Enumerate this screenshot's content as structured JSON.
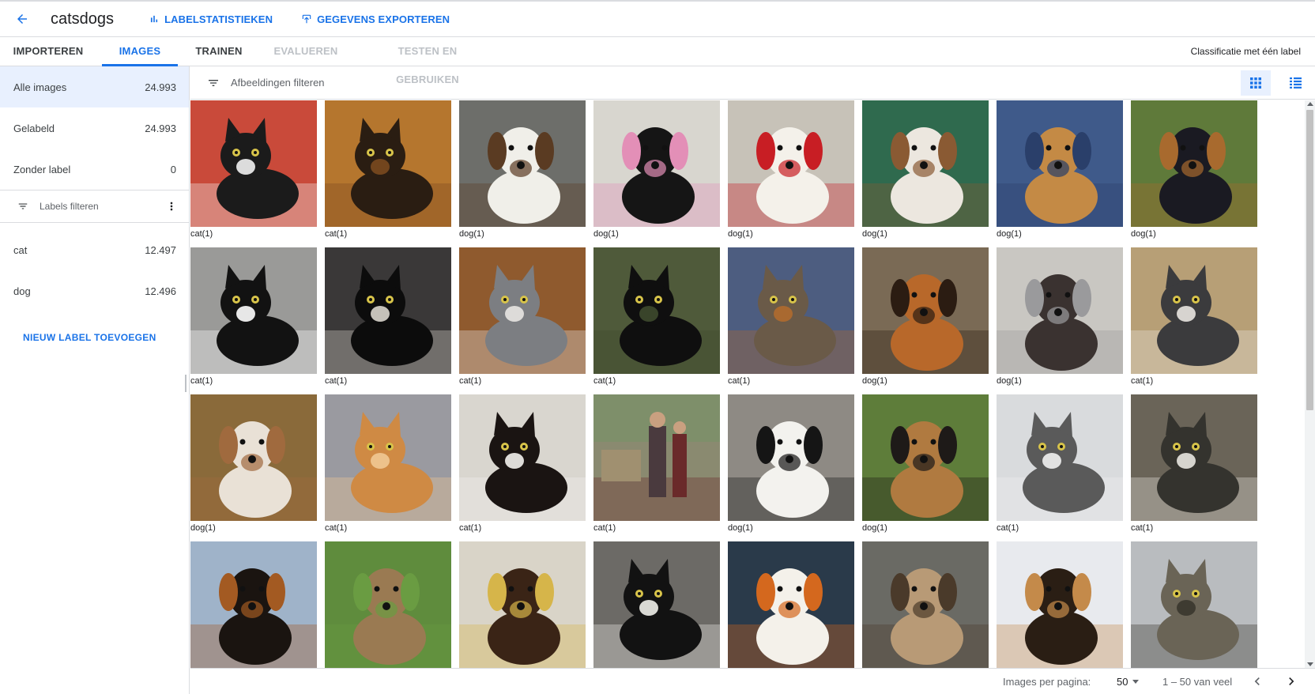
{
  "header": {
    "title": "catsdogs",
    "buttons": [
      {
        "label": "LABELSTATISTIEKEN",
        "icon": "bar-chart-icon"
      },
      {
        "label": "GEGEVENS EXPORTEREN",
        "icon": "export-icon"
      }
    ]
  },
  "tabs": [
    {
      "label": "IMPORTEREN",
      "state": "normal"
    },
    {
      "label": "IMAGES",
      "state": "active"
    },
    {
      "label": "TRAINEN",
      "state": "normal"
    },
    {
      "label": "EVALUEREN",
      "state": "disabled"
    },
    {
      "label": "TESTEN EN GEBRUIKEN",
      "state": "disabled"
    }
  ],
  "classification_type": "Classificatie met één label",
  "sidebar": {
    "items": [
      {
        "label": "Alle images",
        "count": "24.993"
      },
      {
        "label": "Gelabeld",
        "count": "24.993"
      },
      {
        "label": "Zonder label",
        "count": "0"
      }
    ],
    "label_filter_placeholder": "Labels filteren",
    "labels": [
      {
        "label": "cat",
        "count": "12.497"
      },
      {
        "label": "dog",
        "count": "12.496"
      }
    ],
    "add_label": "NIEUW LABEL TOEVOEGEN"
  },
  "main": {
    "filter_placeholder": "Afbeeldingen filteren",
    "images": [
      {
        "caption": "cat(1)",
        "kind": "cat",
        "bg": "#c94a3a",
        "fg": "#1b1b1b",
        "accent": "#f2f2f2"
      },
      {
        "caption": "cat(1)",
        "kind": "cat",
        "bg": "#b5762e",
        "fg": "#2a1d12",
        "accent": "#7a4a1f"
      },
      {
        "caption": "dog(1)",
        "kind": "dog",
        "bg": "#6d6e6a",
        "fg": "#f0efe9",
        "accent": "#5a3b22"
      },
      {
        "caption": "dog(1)",
        "kind": "dog",
        "bg": "#d8d6cf",
        "fg": "#151515",
        "accent": "#e38fb7"
      },
      {
        "caption": "dog(1)",
        "kind": "dog",
        "bg": "#c7c2b8",
        "fg": "#f4f1ea",
        "accent": "#c81e24"
      },
      {
        "caption": "dog(1)",
        "kind": "dog",
        "bg": "#2f6a4e",
        "fg": "#ece7df",
        "accent": "#8a5a33"
      },
      {
        "caption": "dog(1)",
        "kind": "dog",
        "bg": "#3f5a8a",
        "fg": "#c48a45",
        "accent": "#2a3f6a"
      },
      {
        "caption": "dog(1)",
        "kind": "dog",
        "bg": "#5f7a3a",
        "fg": "#1a1a22",
        "accent": "#a86a2e"
      },
      {
        "caption": "cat(1)",
        "kind": "cat",
        "bg": "#9a9a98",
        "fg": "#121212",
        "accent": "#ffffff"
      },
      {
        "caption": "cat(1)",
        "kind": "cat",
        "bg": "#3a3838",
        "fg": "#0c0c0c",
        "accent": "#d9d5cc"
      },
      {
        "caption": "cat(1)",
        "kind": "cat",
        "bg": "#8f5a2e",
        "fg": "#7c7e82",
        "accent": "#e8e6e2"
      },
      {
        "caption": "cat(1)",
        "kind": "cat",
        "bg": "#4f5a3a",
        "fg": "#0f0f0f",
        "accent": "#3e4a2e"
      },
      {
        "caption": "cat(1)",
        "kind": "cat",
        "bg": "#4d5d80",
        "fg": "#6a5a48",
        "accent": "#b06a2e"
      },
      {
        "caption": "dog(1)",
        "kind": "dog",
        "bg": "#7a6a55",
        "fg": "#b8682a",
        "accent": "#2b1c12"
      },
      {
        "caption": "dog(1)",
        "kind": "dog",
        "bg": "#c9c7c2",
        "fg": "#3a3230",
        "accent": "#9a9a9c"
      },
      {
        "caption": "cat(1)",
        "kind": "cat",
        "bg": "#b79f76",
        "fg": "#3b3b3d",
        "accent": "#e9e6e0"
      },
      {
        "caption": "dog(1)",
        "kind": "dog",
        "bg": "#8a6a3a",
        "fg": "#e9e1d6",
        "accent": "#a06a3e"
      },
      {
        "caption": "cat(1)",
        "kind": "cat",
        "bg": "#9a9aa0",
        "fg": "#cf8a44",
        "accent": "#f0c894"
      },
      {
        "caption": "cat(1)",
        "kind": "cat",
        "bg": "#d9d6cf",
        "fg": "#1a1412",
        "accent": "#f4f2ee"
      },
      {
        "caption": "cat(1)",
        "kind": "scene",
        "bg": "#8a8a70",
        "fg": "#4a3a3e",
        "accent": "#6a2a2a"
      },
      {
        "caption": "dog(1)",
        "kind": "dog",
        "bg": "#8e8a84",
        "fg": "#f3f2ee",
        "accent": "#151515"
      },
      {
        "caption": "dog(1)",
        "kind": "dog",
        "bg": "#5e7d3a",
        "fg": "#b07a40",
        "accent": "#1e1a18"
      },
      {
        "caption": "cat(1)",
        "kind": "cat",
        "bg": "#d9dbdd",
        "fg": "#5a5a5a",
        "accent": "#f1f1f1"
      },
      {
        "caption": "cat(1)",
        "kind": "cat",
        "bg": "#6a6458",
        "fg": "#34332e",
        "accent": "#e8e6e0"
      },
      {
        "caption": "",
        "kind": "dog",
        "bg": "#9fb3c9",
        "fg": "#1a1410",
        "accent": "#a35a22"
      },
      {
        "caption": "",
        "kind": "dog",
        "bg": "#5f8c3d",
        "fg": "#9a7a52",
        "accent": "#6a9c42"
      },
      {
        "caption": "",
        "kind": "dog",
        "bg": "#d9d4c8",
        "fg": "#3a2416",
        "accent": "#d6b54a"
      },
      {
        "caption": "",
        "kind": "cat",
        "bg": "#6c6a66",
        "fg": "#121212",
        "accent": "#f0efea"
      },
      {
        "caption": "",
        "kind": "dog",
        "bg": "#2a3a4a",
        "fg": "#f4f1ea",
        "accent": "#d4681e"
      },
      {
        "caption": "",
        "kind": "dog",
        "bg": "#6a6a64",
        "fg": "#b89a76",
        "accent": "#4a3a2a"
      },
      {
        "caption": "",
        "kind": "dog",
        "bg": "#e8eaee",
        "fg": "#2a1e14",
        "accent": "#c48a4a"
      },
      {
        "caption": "",
        "kind": "cat",
        "bg": "#b9bcbf",
        "fg": "#6a6456",
        "accent": "#3a362e"
      }
    ]
  },
  "pagination": {
    "per_page_label": "Images per pagina:",
    "per_page_value": "50",
    "range": "1 – 50 van veel"
  }
}
